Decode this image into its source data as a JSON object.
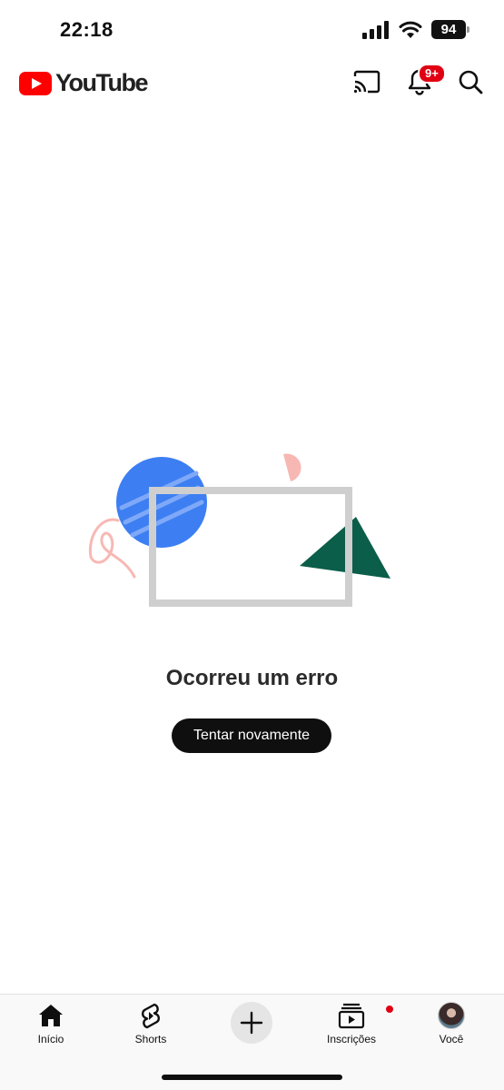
{
  "status_bar": {
    "time": "22:18",
    "battery": "94"
  },
  "header": {
    "logo_text": "YouTube",
    "notification_badge": "9+",
    "icons": [
      "cast-icon",
      "bell-icon",
      "search-icon"
    ]
  },
  "error": {
    "message": "Ocorreu um erro",
    "retry_label": "Tentar novamente"
  },
  "bottom_nav": {
    "items": [
      {
        "label": "Início",
        "icon": "home-icon"
      },
      {
        "label": "Shorts",
        "icon": "shorts-icon"
      },
      {
        "label": "",
        "icon": "plus-icon"
      },
      {
        "label": "Inscrições",
        "icon": "subscriptions-icon"
      },
      {
        "label": "Você",
        "icon": "avatar"
      }
    ]
  },
  "colors": {
    "brand_red": "#ff0000",
    "badge_red": "#e00012",
    "button_dark": "#0f0f0f",
    "illustration_blue": "#3d7ff2",
    "illustration_green": "#0b5e4a",
    "illustration_pink": "#f7b8b4"
  }
}
